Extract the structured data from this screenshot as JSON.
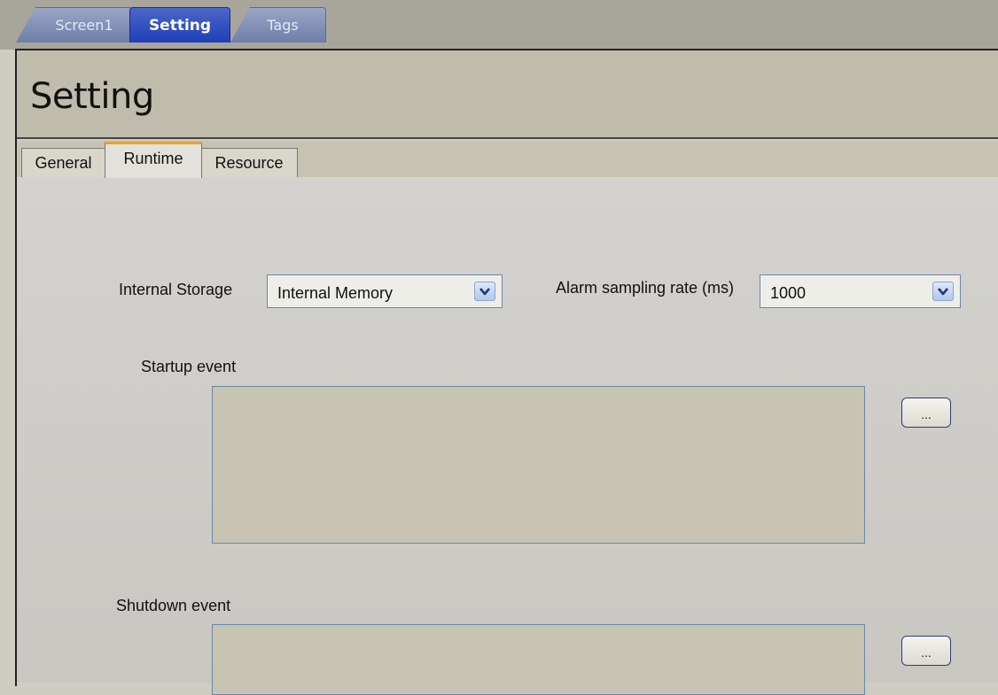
{
  "doc_tabs": [
    {
      "label": "Screen1",
      "active": false
    },
    {
      "label": "Setting",
      "active": true
    },
    {
      "label": "Tags",
      "active": false
    }
  ],
  "page_title": "Setting",
  "sub_tabs": [
    {
      "label": "General",
      "active": false
    },
    {
      "label": "Runtime",
      "active": true
    },
    {
      "label": "Resource",
      "active": false
    }
  ],
  "runtime": {
    "internal_storage": {
      "label": "Internal Storage",
      "value": "Internal Memory"
    },
    "alarm_sampling": {
      "label": "Alarm sampling rate (ms)",
      "value": "1000"
    },
    "startup_event": {
      "label": "Startup event",
      "button": "..."
    },
    "shutdown_event": {
      "label": "Shutdown event",
      "button": "..."
    }
  },
  "colors": {
    "active_tab": "#1f3fb7",
    "inactive_tab": "#7f8fb8",
    "selected_subtab_accent": "#e9a32a",
    "title_bar": "#bfbcab",
    "event_box": "#c7c4b4"
  },
  "icons": [
    "chevron-down-icon"
  ]
}
